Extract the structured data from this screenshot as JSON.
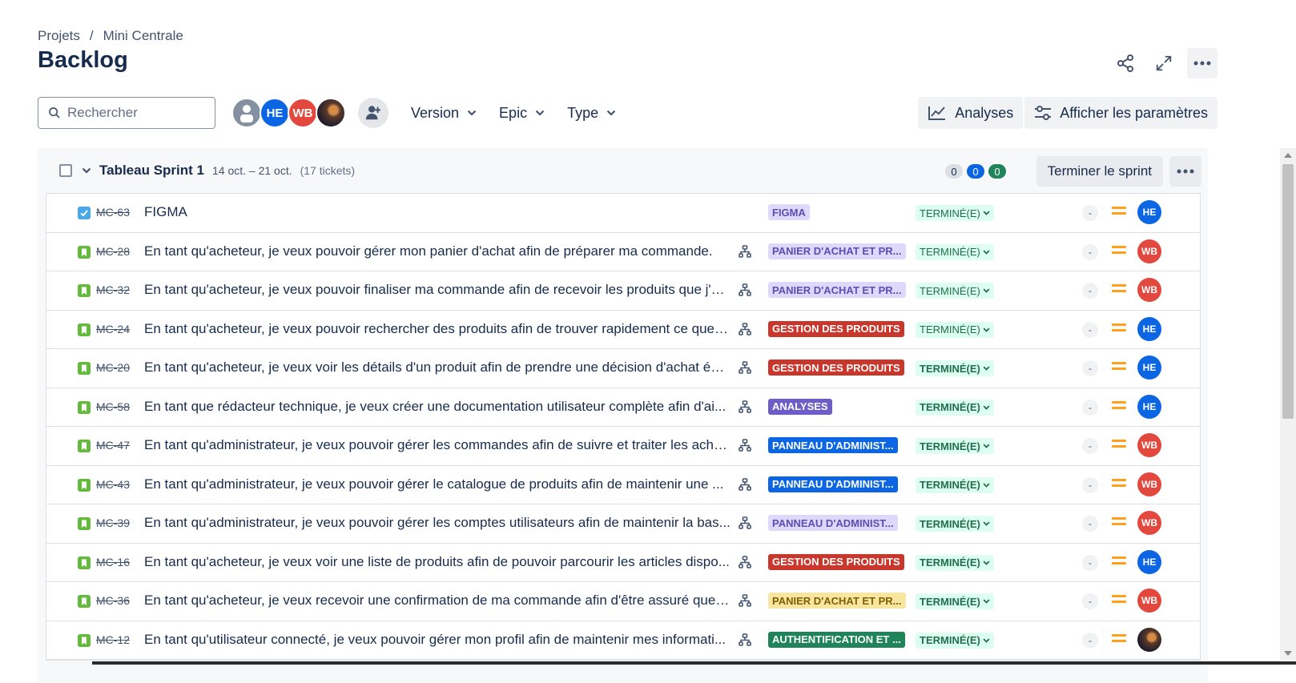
{
  "breadcrumb": {
    "root": "Projets",
    "separator": "/",
    "project": "Mini Centrale"
  },
  "page": {
    "title": "Backlog"
  },
  "toolbar": {
    "search_placeholder": "Rechercher",
    "avatars": [
      "user-icon",
      "HE",
      "WB",
      "photo"
    ],
    "filters": [
      {
        "label": "Version"
      },
      {
        "label": "Epic"
      },
      {
        "label": "Type"
      }
    ],
    "analytics_label": "Analyses",
    "view_settings_label": "Afficher les paramètres"
  },
  "sprint": {
    "name": "Tableau Sprint 1",
    "dates": "14 oct. – 21 oct.",
    "ticket_count": "(17 tickets)",
    "counts": {
      "todo": "0",
      "in_progress": "0",
      "done": "0"
    },
    "finish_label": "Terminer le sprint"
  },
  "colors": {
    "accent": "#0c66e4",
    "status_bg": "#dcfff1",
    "status_text": "#216e4e",
    "priority_medium": "#ff9f1a"
  },
  "issues": [
    {
      "type": "task",
      "key": "MC-63",
      "summary": "FIGMA",
      "has_children": false,
      "epic": "FIGMA",
      "epic_style": "purple",
      "status": "TERMINÉ(E)",
      "status_bold": false,
      "estimate": "-",
      "priority": "medium",
      "assignee": "HE"
    },
    {
      "type": "story",
      "key": "MC-28",
      "summary": "En tant qu'acheteur, je veux pouvoir gérer mon panier d'achat afin de préparer ma commande.",
      "has_children": true,
      "epic": "PANIER D'ACHAT ET PR...",
      "epic_style": "purple",
      "status": "TERMINÉ(E)",
      "status_bold": false,
      "estimate": "-",
      "priority": "medium",
      "assignee": "WB"
    },
    {
      "type": "story",
      "key": "MC-32",
      "summary": "En tant qu'acheteur, je veux pouvoir finaliser ma commande afin de recevoir les produits que j'ai...",
      "has_children": true,
      "epic": "PANIER D'ACHAT ET PR...",
      "epic_style": "purple",
      "status": "TERMINÉ(E)",
      "status_bold": false,
      "estimate": "-",
      "priority": "medium",
      "assignee": "WB"
    },
    {
      "type": "story",
      "key": "MC-24",
      "summary": "En tant qu'acheteur, je veux pouvoir rechercher des produits afin de trouver rapidement ce que j...",
      "has_children": true,
      "epic": "GESTION DES PRODUITS",
      "epic_style": "red",
      "status": "TERMINÉ(E)",
      "status_bold": false,
      "estimate": "-",
      "priority": "medium",
      "assignee": "HE"
    },
    {
      "type": "story",
      "key": "MC-20",
      "summary": "En tant qu'acheteur, je veux voir les détails d'un produit afin de prendre une décision d'achat écl...",
      "has_children": true,
      "epic": "GESTION DES PRODUITS",
      "epic_style": "red",
      "status": "TERMINÉ(E)",
      "status_bold": true,
      "estimate": "-",
      "priority": "medium",
      "assignee": "HE"
    },
    {
      "type": "story",
      "key": "MC-58",
      "summary": "En tant que rédacteur technique, je veux créer une documentation utilisateur complète afin d'ai...",
      "has_children": true,
      "epic": "ANALYSES",
      "epic_style": "violet",
      "status": "TERMINÉ(E)",
      "status_bold": true,
      "estimate": "-",
      "priority": "medium",
      "assignee": "HE"
    },
    {
      "type": "story",
      "key": "MC-47",
      "summary": "En tant qu'administrateur, je veux pouvoir gérer les commandes afin de suivre et traiter les acha...",
      "has_children": true,
      "epic": "PANNEAU D'ADMINIST...",
      "epic_style": "blue",
      "status": "TERMINÉ(E)",
      "status_bold": true,
      "estimate": "-",
      "priority": "medium",
      "assignee": "WB"
    },
    {
      "type": "story",
      "key": "MC-43",
      "summary": "En tant qu'administrateur, je veux pouvoir gérer le catalogue de produits afin de maintenir une ...",
      "has_children": true,
      "epic": "PANNEAU D'ADMINIST...",
      "epic_style": "blue",
      "status": "TERMINÉ(E)",
      "status_bold": true,
      "estimate": "-",
      "priority": "medium",
      "assignee": "WB"
    },
    {
      "type": "story",
      "key": "MC-39",
      "summary": "En tant qu'administrateur, je veux pouvoir gérer les comptes utilisateurs afin de maintenir la bas...",
      "has_children": true,
      "epic": "PANNEAU D'ADMINIST...",
      "epic_style": "purple",
      "status": "TERMINÉ(E)",
      "status_bold": true,
      "estimate": "-",
      "priority": "medium",
      "assignee": "WB"
    },
    {
      "type": "story",
      "key": "MC-16",
      "summary": "En tant qu'acheteur, je veux voir une liste de produits afin de pouvoir parcourir les articles dispo...",
      "has_children": true,
      "epic": "GESTION DES PRODUITS",
      "epic_style": "red",
      "status": "TERMINÉ(E)",
      "status_bold": true,
      "estimate": "-",
      "priority": "medium",
      "assignee": "HE"
    },
    {
      "type": "story",
      "key": "MC-36",
      "summary": "En tant qu'acheteur, je veux recevoir une confirmation de ma commande afin d'être assuré que ...",
      "has_children": true,
      "epic": "PANIER D'ACHAT ET PR...",
      "epic_style": "yellow",
      "status": "TERMINÉ(E)",
      "status_bold": true,
      "estimate": "-",
      "priority": "medium",
      "assignee": "WB"
    },
    {
      "type": "story",
      "key": "MC-12",
      "summary": "En tant qu'utilisateur connecté, je veux pouvoir gérer mon profil afin de maintenir mes informati...",
      "has_children": true,
      "epic": "AUTHENTIFICATION ET ...",
      "epic_style": "green",
      "status": "TERMINÉ(E)",
      "status_bold": true,
      "estimate": "-",
      "priority": "medium",
      "assignee": "photo"
    }
  ]
}
